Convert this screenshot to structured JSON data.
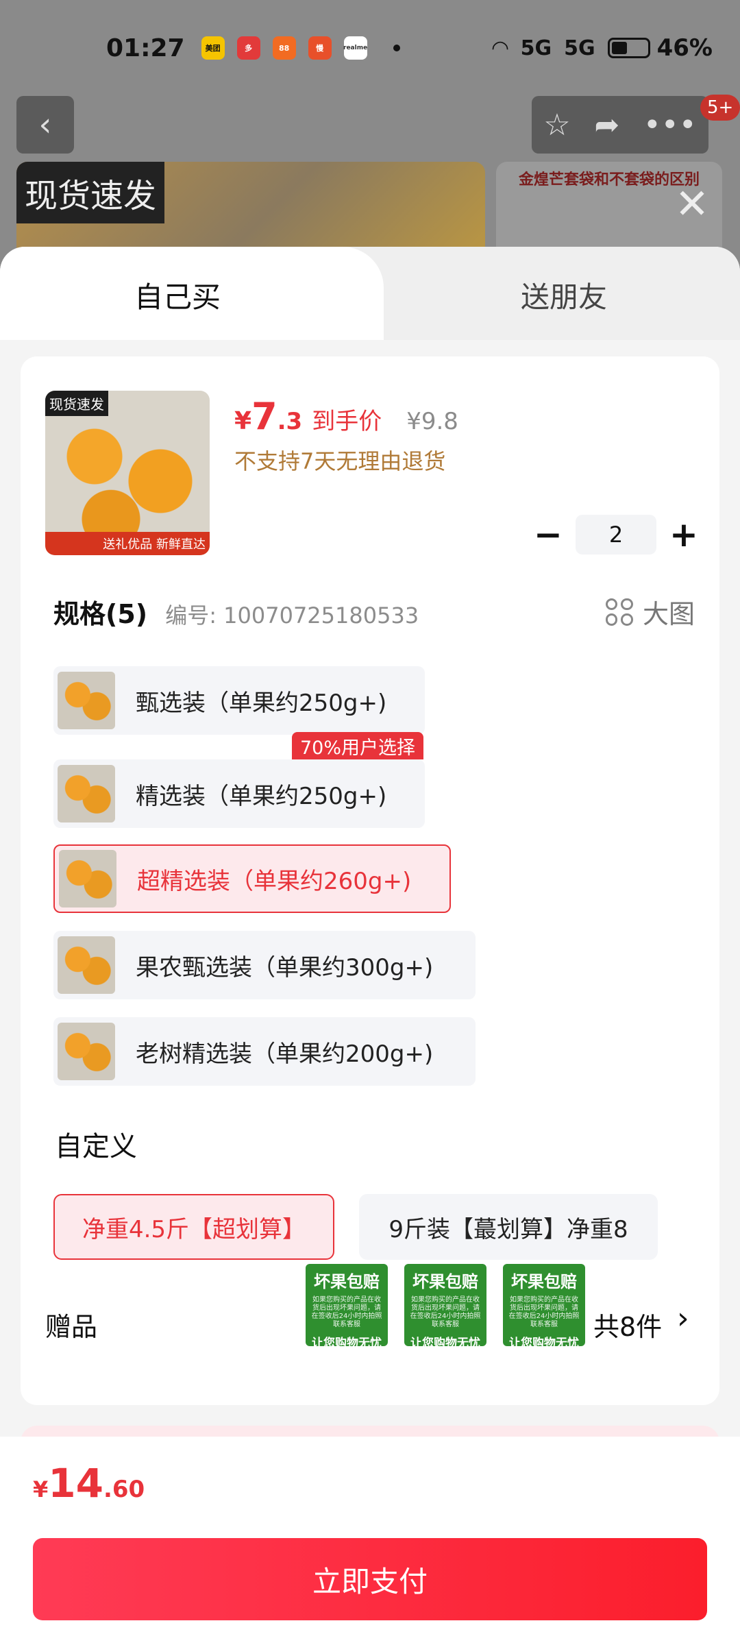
{
  "status_bar": {
    "time": "01:27",
    "app_icons": [
      "美团",
      "多",
      "88",
      "慢",
      "realme"
    ],
    "network_1": "5G",
    "network_2": "5G",
    "battery": "46%"
  },
  "background_page": {
    "cart_badge": "5+",
    "image_tag": "现货速发",
    "side_image_title": "金煌芒套袋和不套袋的区别"
  },
  "tabs": {
    "self": "自己买",
    "gift": "送朋友"
  },
  "product": {
    "thumb_tag_top": "现货速发",
    "thumb_tag_bottom": "送礼优品 新鲜直达",
    "price_symbol": "¥",
    "price_int": "7",
    "price_dec": ".3",
    "price_label": "到手价",
    "original_price": "¥9.8",
    "return_policy": "不支持7天无理由退货"
  },
  "quantity": {
    "minus": "−",
    "value": "2",
    "plus": "+"
  },
  "spec": {
    "title": "规格(5)",
    "code": "编号: 10070725180533",
    "big_image": "大图",
    "popular_badge": "70%用户选择",
    "options": [
      {
        "label": "甄选装（单果约250g+)",
        "selected": false
      },
      {
        "label": "精选装（单果约250g+)",
        "selected": false
      },
      {
        "label": "超精选装（单果约260g+)",
        "selected": true
      },
      {
        "label": "果农甄选装（单果约300g+)",
        "selected": false
      },
      {
        "label": "老树精选装（单果约200g+)",
        "selected": false
      }
    ]
  },
  "custom": {
    "title": "自定义",
    "options": [
      {
        "label": "净重4.5斤【超划算】",
        "selected": true
      },
      {
        "label": "9斤装【蕞划算】净重8",
        "selected": false
      }
    ]
  },
  "gift": {
    "label": "赠品",
    "card_title": "坏果包赔",
    "card_fine": "如果您购买的产品在收货后出现坏果问题，请在签收后24小时内拍照联系客服",
    "card_slogan": "让您购物无忧",
    "count": "共8件",
    "arrow": "›"
  },
  "footer": {
    "total_symbol": "¥",
    "total_int": "14",
    "total_dec": ".60",
    "pay_button": "立即支付"
  },
  "colors": {
    "accent": "#e8333a",
    "selected_bg": "#fde9ec",
    "return_text": "#b07a37",
    "gift_green": "#2f8f2f"
  }
}
